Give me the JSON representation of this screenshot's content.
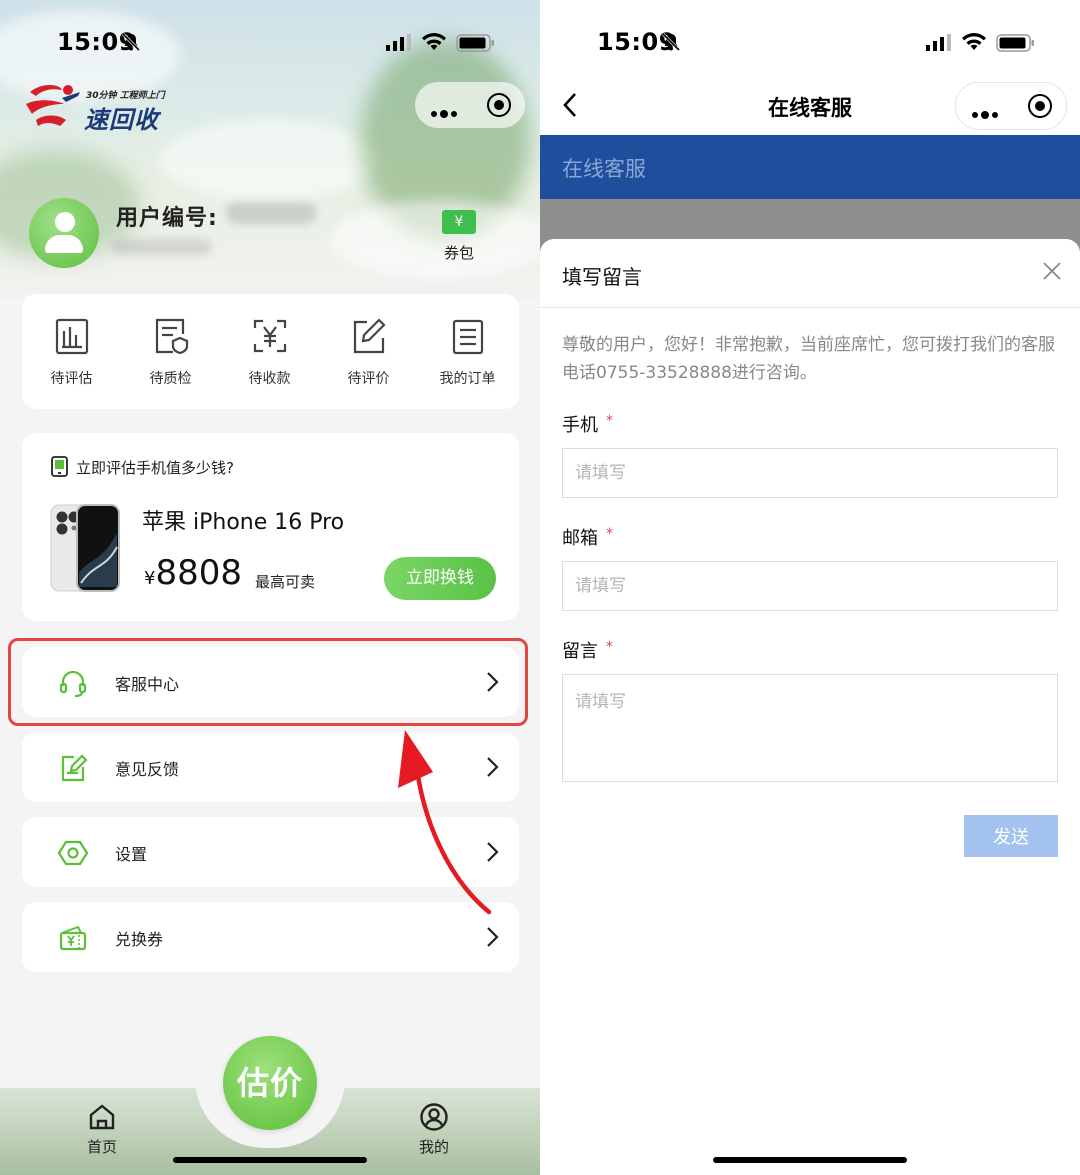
{
  "status_bar": {
    "time": "15:09"
  },
  "left": {
    "brand": {
      "slogan": "30分钟 工程师上门",
      "name": "速回收"
    },
    "user": {
      "id_label": "用户编号:"
    },
    "coupon_wallet": {
      "icon_symbol": "¥",
      "label": "券包"
    },
    "orders": [
      {
        "label": "待评估",
        "icon": "chart-clipboard-icon"
      },
      {
        "label": "待质检",
        "icon": "inspection-clipboard-icon"
      },
      {
        "label": "待收款",
        "icon": "yuan-scan-icon"
      },
      {
        "label": "待评价",
        "icon": "edit-pen-icon"
      },
      {
        "label": "我的订单",
        "icon": "order-list-icon"
      }
    ],
    "evaluate": {
      "question": "立即评估手机值多少钱?",
      "model": "苹果 iPhone 16 Pro",
      "currency": "¥",
      "price": "8808",
      "price_note": "最高可卖",
      "button": "立即换钱"
    },
    "menu": [
      {
        "label": "客服中心",
        "icon": "headset-icon"
      },
      {
        "label": "意见反馈",
        "icon": "feedback-icon"
      },
      {
        "label": "设置",
        "icon": "settings-hex-icon"
      },
      {
        "label": "兑换券",
        "icon": "voucher-icon"
      }
    ],
    "tabbar": {
      "home": "首页",
      "estimate": "估价",
      "mine": "我的"
    },
    "colors": {
      "accent": "#5bbf3a",
      "highlight": "#e34545"
    }
  },
  "right": {
    "nav_title": "在线客服",
    "banner_title": "在线客服",
    "sheet": {
      "title": "填写留言",
      "notice": "尊敬的用户，您好！非常抱歉，当前座席忙，您可拨打我们的客服电话0755-33528888进行咨询。",
      "fields": [
        {
          "label": "手机",
          "required": "*",
          "placeholder": "请填写"
        },
        {
          "label": "邮箱",
          "required": "*",
          "placeholder": "请填写"
        },
        {
          "label": "留言",
          "required": "*",
          "placeholder": "请填写"
        }
      ],
      "send": "发送"
    },
    "colors": {
      "banner": "#1f4e9c",
      "send_button": "#a3c2f0"
    }
  }
}
